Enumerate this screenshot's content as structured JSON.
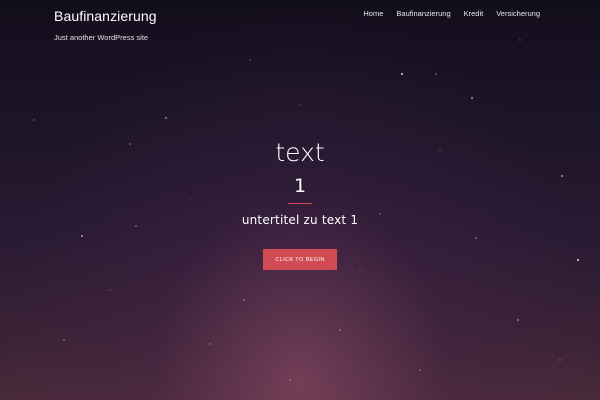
{
  "header": {
    "site_title": "Baufinanzierung",
    "tagline": "Just another WordPress site",
    "nav": [
      {
        "label": "Home"
      },
      {
        "label": "Baufinanzierung"
      },
      {
        "label": "Kredit"
      },
      {
        "label": "Versicherung"
      }
    ]
  },
  "hero": {
    "title_line1": "text",
    "title_line2": "1",
    "subtitle": "untertitel zu text 1",
    "button_label": "Click to begin"
  },
  "colors": {
    "accent": "#d14b55",
    "background_top": "#120d1b",
    "background_bottom": "#4a2a3a"
  }
}
